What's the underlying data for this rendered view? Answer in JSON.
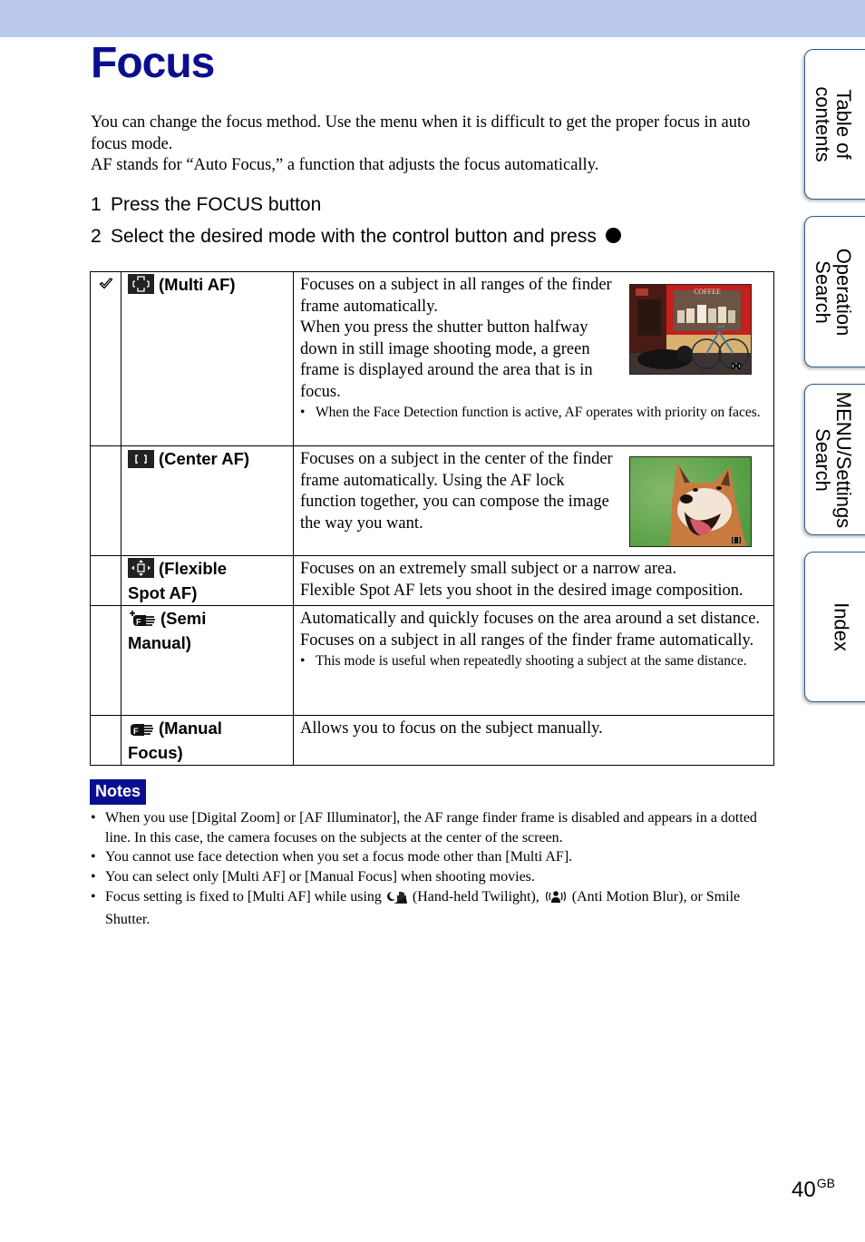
{
  "page": {
    "title": "Focus",
    "intro": [
      "You can change the focus method. Use the menu when it is difficult to get the proper focus in auto focus mode.",
      "AF stands for “Auto Focus,” a function that adjusts the focus automatically."
    ],
    "steps": [
      {
        "number": "1",
        "text": "Press the FOCUS button"
      },
      {
        "number": "2",
        "text": "Select the desired mode with the control button and press"
      }
    ],
    "enter_icon": "filled-circle-button-icon"
  },
  "modes": [
    {
      "icon": "multi-af-icon",
      "name": "(Multi AF)",
      "default": true,
      "description": "Focuses on a subject in all ranges of the finder frame automatically.",
      "description2": "When you press the shutter button halfway down in still image shooting mode, a green frame is displayed around the area that is in focus.",
      "bullet": "When the Face Detection function is active, AF operates with priority on faces.",
      "photo": "coffee-shop-bicycle-dog-photo",
      "photo_sign": "COFFEE"
    },
    {
      "icon": "center-af-icon",
      "name": "(Center AF)",
      "default": false,
      "description": "Focuses on a subject in the center of the finder frame automatically. Using the AF lock function together, you can compose the image the way you want.",
      "photo": "shiba-dog-photo"
    },
    {
      "icon": "flexible-spot-af-icon",
      "name_line1": "(Flexible",
      "name_line2": "Spot AF)",
      "default": false,
      "description": "Focuses on an extremely small subject or a narrow area.",
      "description2": "Flexible Spot AF lets you shoot in the desired image composition."
    },
    {
      "icon": "semi-manual-focus-icon",
      "name_line1": "(Semi",
      "name_line2": "Manual)",
      "default": false,
      "description": "Automatically and quickly focuses on the area around a set distance. Focuses on a subject in all ranges of the finder frame automatically.",
      "bullet": "This mode is useful when repeatedly shooting a subject at the same distance."
    },
    {
      "icon": "manual-focus-icon",
      "name_line1": "(Manual",
      "name_line2": "Focus)",
      "default": false,
      "description": "Allows you to focus on the subject manually."
    }
  ],
  "notes": {
    "label": "Notes",
    "items": [
      "When you use [Digital Zoom] or [AF Illuminator], the AF range finder frame is disabled and appears in a dotted line. In this case, the camera focuses on the subjects at the center of the screen.",
      "You cannot use face detection when you set a focus mode other than [Multi AF].",
      "You can select only [Multi AF] or [Manual Focus] when shooting movies."
    ],
    "last_item": {
      "prefix": "Focus setting is fixed to [Multi AF] while using",
      "twilight_label": "(Hand-held Twilight),",
      "antiblur_label": "(Anti Motion Blur), or Smile Shutter."
    }
  },
  "side_tabs": [
    {
      "line1": "Table of",
      "line2": "contents"
    },
    {
      "line1": "Operation",
      "line2": "Search"
    },
    {
      "line1": "MENU/Settings",
      "line2": "Search"
    },
    {
      "line1": "Index",
      "line2": ""
    }
  ],
  "footer": {
    "page_number": "40",
    "suffix": "GB"
  },
  "colors": {
    "title": "#0b0f8f",
    "top_band": "#b9c8eb",
    "notes_bg": "#0b0f8f",
    "tab_border": "#2d5a8f"
  }
}
